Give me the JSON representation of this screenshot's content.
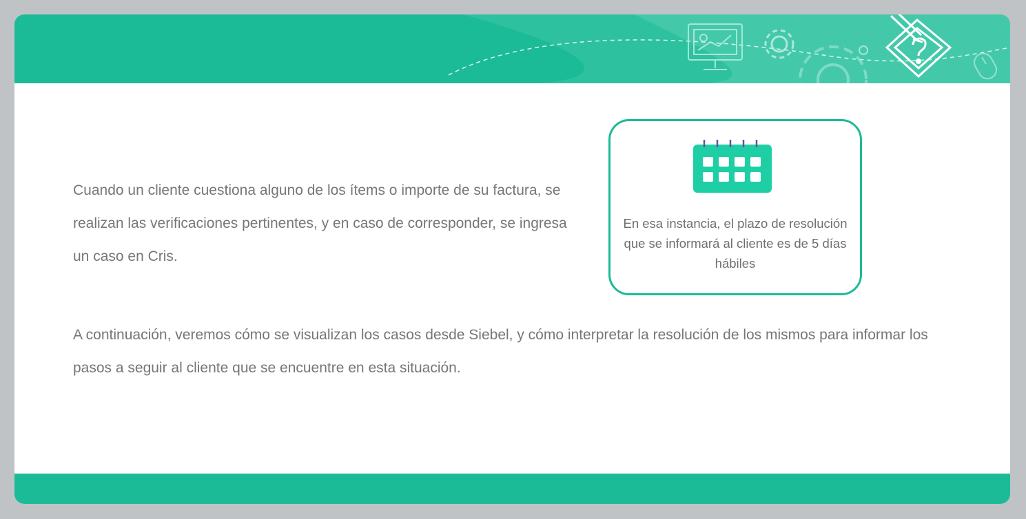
{
  "colors": {
    "accent": "#1cbb98",
    "calendar_icon": "#1ecfa6",
    "calendar_rings": "#6a4fa3",
    "text": "#767676",
    "frame": "#bfc3c6"
  },
  "header": {
    "icons": [
      "presentation-screen-icon",
      "gear-icon",
      "large-gear-icon",
      "question-document-pencil-icon",
      "mouse-icon"
    ]
  },
  "main": {
    "intro_text": "Cuando un cliente cuestiona alguno de los ítems o importe de su factura, se realizan las verificaciones pertinentes, y en caso de corresponder, se ingresa un caso en Cris.",
    "info_box": {
      "icon": "calendar-icon",
      "text": "En esa instancia, el plazo de resolución que se informará al cliente es de 5 días hábiles"
    },
    "outro_text": "A continuación, veremos cómo se visualizan los casos desde Siebel, y cómo interpretar la resolución de los mismos para informar los pasos a seguir al cliente que se encuentre en esta situación."
  }
}
